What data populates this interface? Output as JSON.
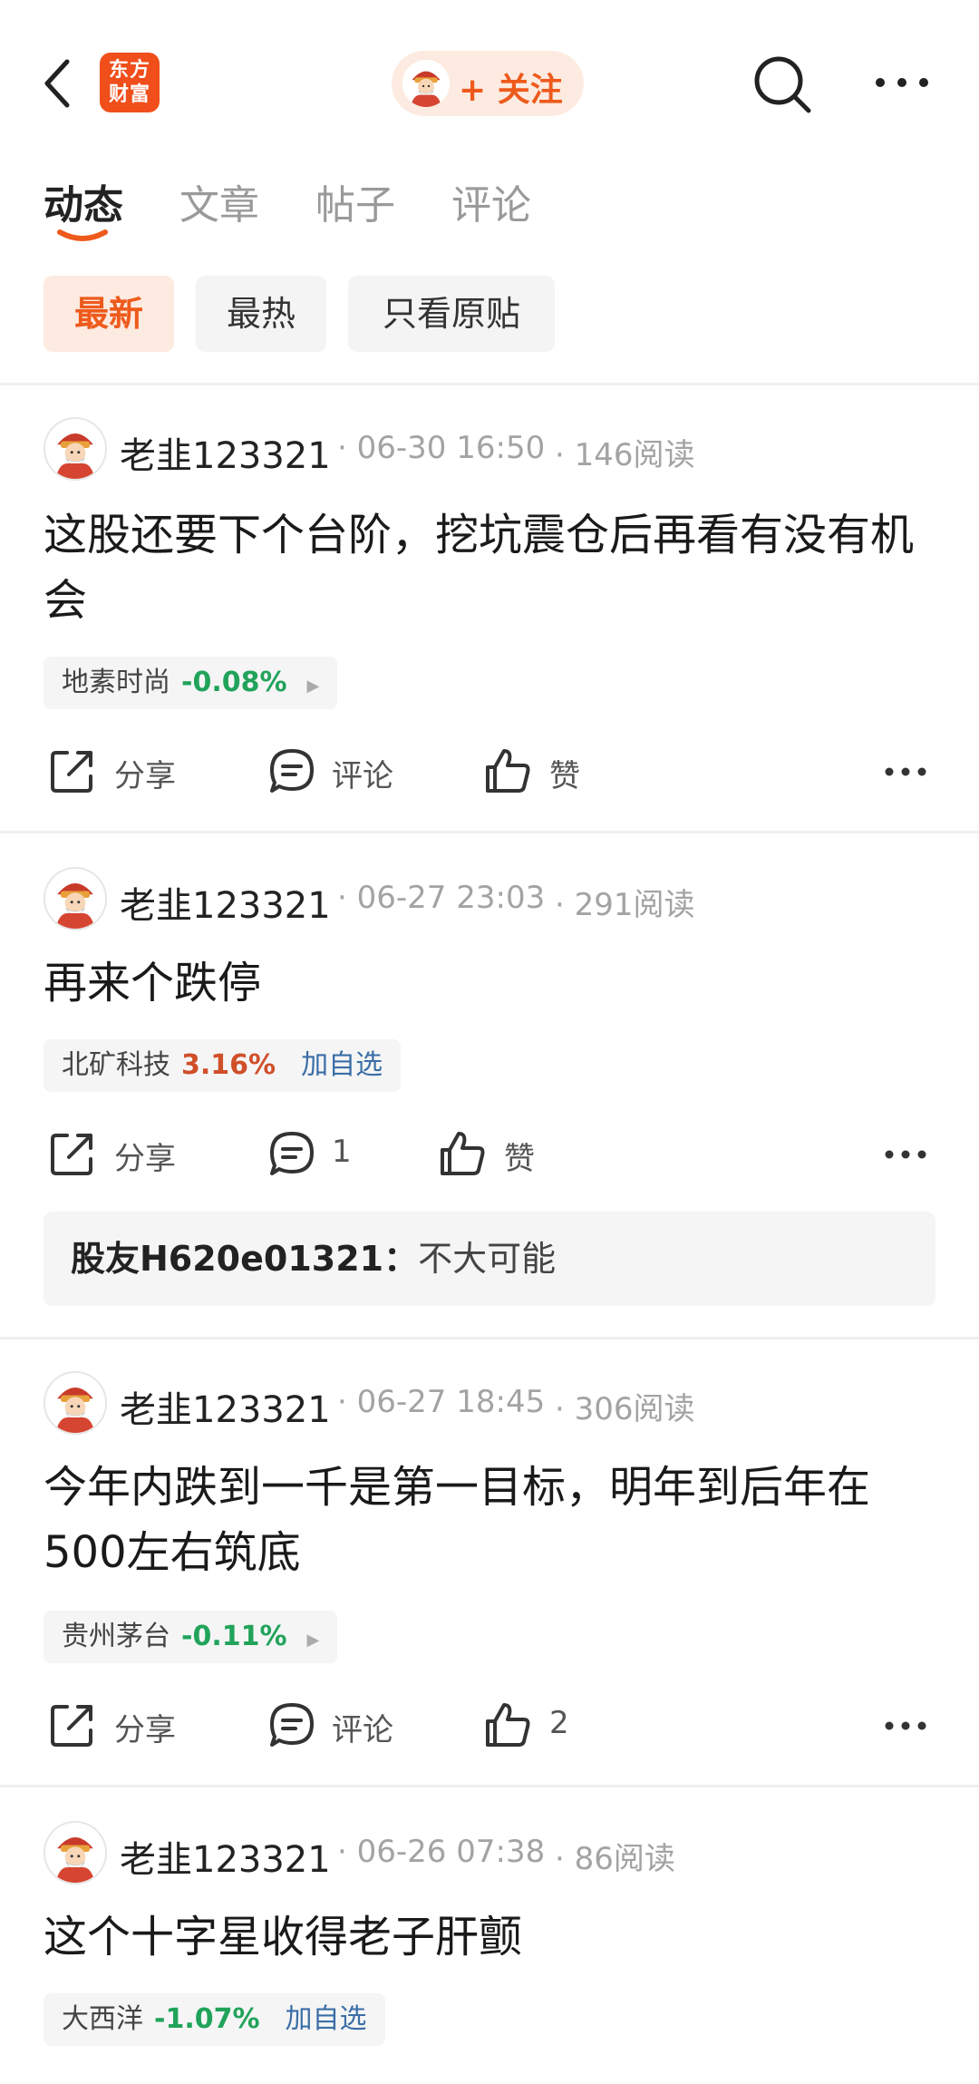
{
  "header": {
    "logo_line1": "东方",
    "logo_line2": "财富",
    "follow_label": "+ 关注"
  },
  "tabs": [
    {
      "label": "动态",
      "active": true
    },
    {
      "label": "文章",
      "active": false
    },
    {
      "label": "帖子",
      "active": false
    },
    {
      "label": "评论",
      "active": false
    }
  ],
  "filters": [
    {
      "label": "最新",
      "active": true
    },
    {
      "label": "最热",
      "active": false
    },
    {
      "label": "只看原贴",
      "active": false
    }
  ],
  "actions": {
    "share": "分享",
    "comment": "评论",
    "like": "赞"
  },
  "colors": {
    "accent": "#ee5a1c",
    "down": "#21a35a",
    "up": "#d0502a",
    "link": "#3a6ea6"
  },
  "posts": [
    {
      "user": "老韭123321",
      "time": "06-30 16:50",
      "reads": "146阅读",
      "text": "这股还要下个台阶，挖坑震仓后再看有没有机会",
      "stock": {
        "name": "地素时尚",
        "change": "-0.08%"
      },
      "comment_count": "评论",
      "like_count": "赞"
    },
    {
      "user": "老韭123321",
      "time": "06-27 23:03",
      "reads": "291阅读",
      "text": "再来个跌停",
      "stock": {
        "name": "北矿科技",
        "change": "3.16%",
        "add": "加自选"
      },
      "comment_count": "1",
      "like_count": "赞",
      "reply": {
        "author": "股友H620e01321",
        "sep": "：",
        "text": "不大可能"
      }
    },
    {
      "user": "老韭123321",
      "time": "06-27 18:45",
      "reads": "306阅读",
      "text": "今年内跌到一千是第一目标，明年到后年在500左右筑底",
      "stock": {
        "name": "贵州茅台",
        "change": "-0.11%"
      },
      "comment_count": "评论",
      "like_count": "2"
    },
    {
      "user": "老韭123321",
      "time": "06-26 07:38",
      "reads": "86阅读",
      "text": "这个十字星收得老子肝颤",
      "stock": {
        "name": "大西洋",
        "change": "-1.07%",
        "add": "加自选"
      }
    }
  ]
}
